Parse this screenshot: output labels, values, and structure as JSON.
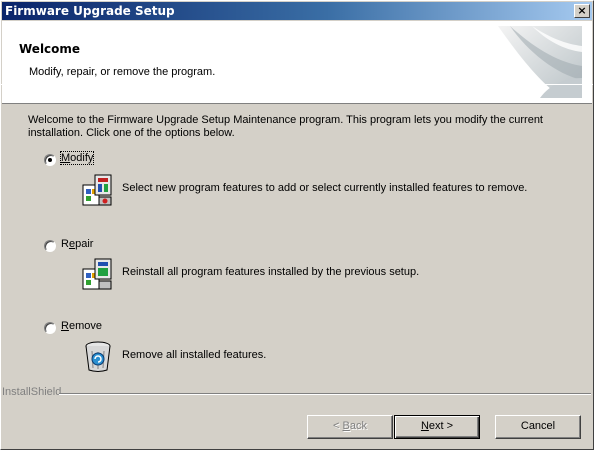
{
  "window": {
    "title": "Firmware Upgrade Setup",
    "close_label": "×"
  },
  "header": {
    "title": "Welcome",
    "subtitle": "Modify, repair, or remove the program."
  },
  "intro": "Welcome to the Firmware Upgrade Setup Maintenance program. This program lets you modify the current installation. Click one of the options below.",
  "options": [
    {
      "label_pre": "",
      "label_ul": "M",
      "label_post": "odify",
      "selected": true,
      "description": "Select new program features to add or select currently installed features to remove."
    },
    {
      "label_pre": "R",
      "label_ul": "e",
      "label_post": "pair",
      "selected": false,
      "description": "Reinstall all program features installed by the previous setup."
    },
    {
      "label_pre": "",
      "label_ul": "R",
      "label_post": "emove",
      "selected": false,
      "description": "Remove all installed features."
    }
  ],
  "footer": {
    "brand": "InstallShield"
  },
  "buttons": {
    "back_pre": "< ",
    "back_ul": "B",
    "back_post": "ack",
    "next_ul": "N",
    "next_post": "ext >",
    "cancel": "Cancel"
  }
}
